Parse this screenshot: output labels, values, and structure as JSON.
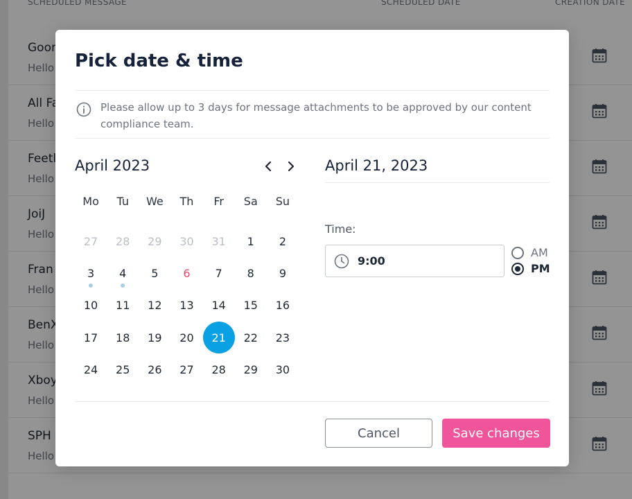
{
  "background": {
    "headers": {
      "message": "SCHEDULED MESSAGE",
      "date": "SCHEDULED DATE",
      "created": "CREATION DATE"
    },
    "rows": [
      {
        "name": "Goor",
        "preview": "Hello"
      },
      {
        "name": "All Fa",
        "preview": "Hello"
      },
      {
        "name": "Feetl",
        "preview": "Hello"
      },
      {
        "name": "JoiJ",
        "preview": "Hello"
      },
      {
        "name": "Fran",
        "preview": "Hello"
      },
      {
        "name": "BenX",
        "preview": "Hello"
      },
      {
        "name": "Xboy",
        "preview": "Hello"
      },
      {
        "name": "SPH",
        "preview": "Hello"
      }
    ]
  },
  "modal": {
    "title": "Pick date & time",
    "info": "Please allow up to 3 days for message attachments to be approved by our content compliance team.",
    "calendar": {
      "month_label": "April 2023",
      "weekdays": [
        "Mo",
        "Tu",
        "We",
        "Th",
        "Fr",
        "Sa",
        "Su"
      ],
      "weeks": [
        [
          {
            "d": "27",
            "muted": true
          },
          {
            "d": "28",
            "muted": true
          },
          {
            "d": "29",
            "muted": true
          },
          {
            "d": "30",
            "muted": true
          },
          {
            "d": "31",
            "muted": true
          },
          {
            "d": "1"
          },
          {
            "d": "2"
          }
        ],
        [
          {
            "d": "3",
            "dot": true
          },
          {
            "d": "4",
            "dot": true
          },
          {
            "d": "5"
          },
          {
            "d": "6",
            "holiday": true
          },
          {
            "d": "7"
          },
          {
            "d": "8"
          },
          {
            "d": "9"
          }
        ],
        [
          {
            "d": "10"
          },
          {
            "d": "11"
          },
          {
            "d": "12"
          },
          {
            "d": "13"
          },
          {
            "d": "14"
          },
          {
            "d": "15"
          },
          {
            "d": "16"
          }
        ],
        [
          {
            "d": "17"
          },
          {
            "d": "18"
          },
          {
            "d": "19"
          },
          {
            "d": "20"
          },
          {
            "d": "21",
            "selected": true
          },
          {
            "d": "22"
          },
          {
            "d": "23"
          }
        ],
        [
          {
            "d": "24"
          },
          {
            "d": "25"
          },
          {
            "d": "26"
          },
          {
            "d": "27"
          },
          {
            "d": "28"
          },
          {
            "d": "29"
          },
          {
            "d": "30"
          }
        ]
      ]
    },
    "selected_date": "April 21, 2023",
    "time": {
      "label": "Time:",
      "value": "9:00",
      "am_label": "AM",
      "pm_label": "PM",
      "selected_period": "PM"
    },
    "buttons": {
      "cancel": "Cancel",
      "save": "Save changes"
    }
  },
  "colors": {
    "accent_blue": "#0aa1e4",
    "save_pink": "#f0549b",
    "holiday_red": "#e84a6c",
    "dot_blue": "#a9cfe6"
  },
  "icons": {
    "info": "info-circle-icon",
    "prev": "chevron-left-icon",
    "next": "chevron-right-icon",
    "clock": "clock-icon",
    "row_action": "calendar-icon"
  }
}
